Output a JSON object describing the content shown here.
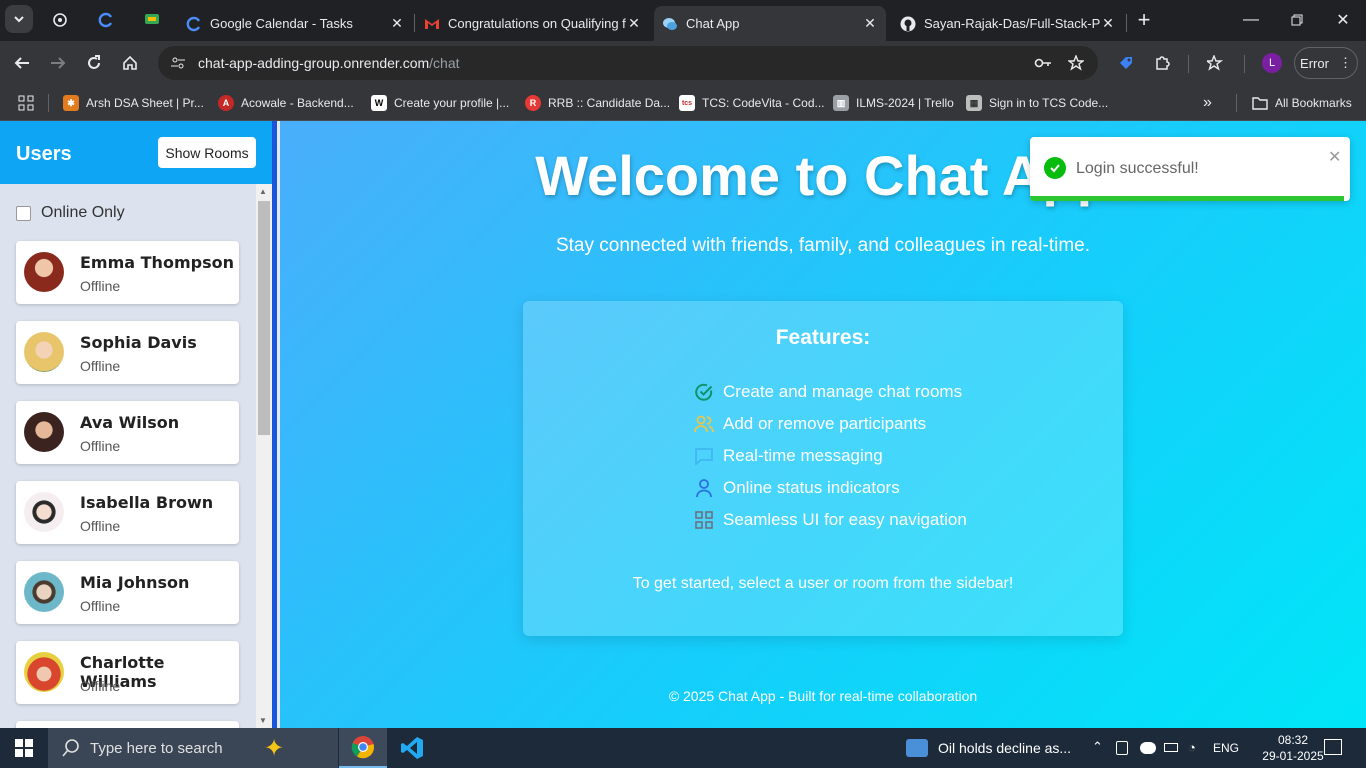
{
  "browser": {
    "tabs": [
      {
        "title": "Google Calendar - Tasks",
        "icon": "google-calendar-icon"
      },
      {
        "title": "Congratulations on Qualifying f",
        "icon": "gmail-icon"
      },
      {
        "title": "Chat App",
        "icon": "chat-app-icon",
        "active": true
      },
      {
        "title": "Sayan-Rajak-Das/Full-Stack-Pro",
        "icon": "github-icon"
      }
    ],
    "url_host": "chat-app-adding-group.onrender.com",
    "url_path": "/chat",
    "error_label": "Error",
    "profile_initial": "L",
    "bookmarks": [
      "Arsh DSA Sheet | Pr...",
      "Acowale - Backend...",
      "Create your profile |...",
      "RRB :: Candidate Da...",
      "TCS: CodeVita - Cod...",
      "ILMS-2024 | Trello",
      "Sign in to TCS Code..."
    ],
    "all_bookmarks": "All Bookmarks"
  },
  "sidebar": {
    "title": "Users",
    "show_rooms": "Show Rooms",
    "online_only": "Online Only",
    "users": [
      {
        "name": "Emma Thompson",
        "status": "Offline"
      },
      {
        "name": "Sophia Davis",
        "status": "Offline"
      },
      {
        "name": "Ava Wilson",
        "status": "Offline"
      },
      {
        "name": "Isabella Brown",
        "status": "Offline"
      },
      {
        "name": "Mia Johnson",
        "status": "Offline"
      },
      {
        "name": "Charlotte Williams",
        "status": "Offline"
      }
    ]
  },
  "main": {
    "welcome": "Welcome to Chat App",
    "tagline": "Stay connected with friends, family, and colleagues in real-time.",
    "features_title": "Features:",
    "features": [
      {
        "text": "Create and manage chat rooms",
        "icon": "check-circle-icon"
      },
      {
        "text": "Add or remove participants",
        "icon": "users-icon"
      },
      {
        "text": "Real-time messaging",
        "icon": "message-icon"
      },
      {
        "text": "Online status indicators",
        "icon": "user-icon"
      },
      {
        "text": "Seamless UI for easy navigation",
        "icon": "grid-icon"
      }
    ],
    "get_started": "To get started, select a user or room from the sidebar!",
    "footer": "© 2025 Chat App - Built for real-time collaboration"
  },
  "toast": {
    "message": "Login successful!",
    "progress": 0.98
  },
  "taskbar": {
    "search_placeholder": "Type here to search",
    "news": "Oil holds decline as...",
    "lang": "ENG",
    "time": "08:32",
    "date": "29-01-2025"
  },
  "colors": {
    "sidebar_header": "#0ea5f4",
    "gradient_start": "#4aaefb",
    "gradient_end": "#00e6f8",
    "toast_success": "#07bc0c"
  }
}
